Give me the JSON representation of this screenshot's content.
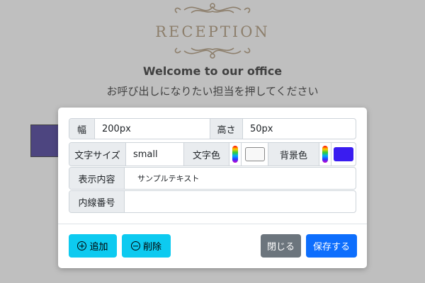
{
  "background": {
    "logo_text": "RECEPTION",
    "welcome": "Welcome to our office",
    "instruction": "お呼び出しになりたい担当を押してください",
    "sample_block_color": "#1a0a80"
  },
  "modal": {
    "width": {
      "label": "幅",
      "value": "200px"
    },
    "height": {
      "label": "高さ",
      "value": "50px"
    },
    "font_size": {
      "label": "文字サイズ",
      "value": "small"
    },
    "text_color": {
      "label": "文字色",
      "swatch": "#f8f8f8",
      "picker_icon": "color-wheel-icon"
    },
    "bg_color": {
      "label": "背景色",
      "swatch": "#3a1cf0",
      "picker_icon": "color-wheel-icon"
    },
    "content": {
      "label": "表示内容",
      "value": "サンプルテキスト"
    },
    "extension": {
      "label": "内線番号",
      "value": ""
    },
    "buttons": {
      "add": "追加",
      "delete": "削除",
      "close": "閉じる",
      "save": "保存する"
    }
  },
  "colors": {
    "info": "#0dcaf0",
    "secondary": "#6c757d",
    "primary": "#0d6efd",
    "overlay": "#808080"
  }
}
